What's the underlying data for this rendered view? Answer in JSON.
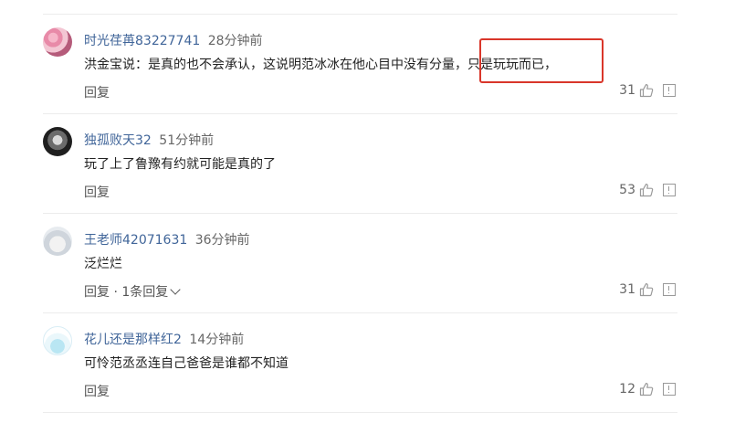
{
  "comments": [
    {
      "username": "时光荏苒83227741",
      "time": "28分钟前",
      "text_main": "洪金宝说：是真的也不会承认，这说明范冰冰在他心目中没有分量，",
      "text_highlight": "只是玩玩而已，",
      "reply": "回复",
      "reply_extra": "",
      "likes": "31",
      "avatar": "flowers-avatar"
    },
    {
      "username": "独孤败天32",
      "time": "51分钟前",
      "text_main": "玩了上了鲁豫有约就可能是真的了",
      "text_highlight": "",
      "reply": "回复",
      "reply_extra": "",
      "likes": "53",
      "avatar": "face-avatar"
    },
    {
      "username": "王老师42071631",
      "time": "36分钟前",
      "text_main": "泛烂烂",
      "text_highlight": "",
      "reply": "回复",
      "reply_extra": " · 1条回复",
      "likes": "31",
      "avatar": "rabbit-avatar"
    },
    {
      "username": "花儿还是那样红2",
      "time": "14分钟前",
      "text_main": "可怜范丞丞连自己爸爸是谁都不知道",
      "text_highlight": "",
      "reply": "回复",
      "reply_extra": "",
      "likes": "12",
      "avatar": "bird-avatar"
    }
  ],
  "colors": {
    "username": "#406599",
    "highlight_border": "#d9362a",
    "divider": "#ececec"
  },
  "icons": [
    "thumbs-up-icon",
    "report-icon",
    "chevron-down-icon"
  ]
}
